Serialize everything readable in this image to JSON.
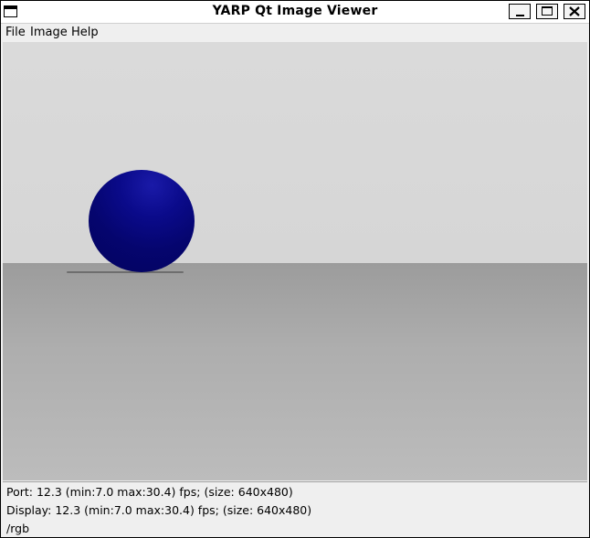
{
  "window": {
    "title": "YARP Qt Image Viewer"
  },
  "menu": {
    "file_label": "File",
    "image_label": "Image",
    "help_label": "Help"
  },
  "scene": {
    "sky_color": "#d9d9d9",
    "ground_color": "#a8a8a8",
    "sphere_color": "#06067a"
  },
  "status": {
    "port_line": "Port: 12.3 (min:7.0 max:30.4) fps; (size: 640x480)",
    "display_line": "Display: 12.3 (min:7.0 max:30.4) fps; (size: 640x480)",
    "port_name": "/rgb"
  },
  "icons": {
    "app": "window-icon",
    "minimize": "minimize-icon",
    "maximize": "maximize-icon",
    "close": "close-icon"
  }
}
